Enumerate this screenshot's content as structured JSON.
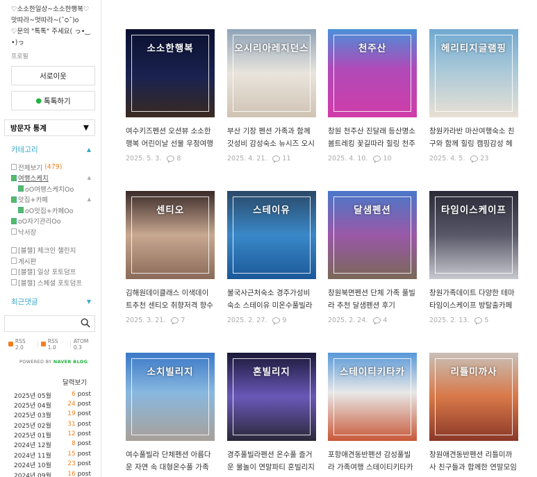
{
  "sidebar": {
    "profile_text": "♡소소한일상~소소한행복♡맛따라~멋따라~(ˆ੦ˆ)о　　　♡문의 \"톡톡\" 주세요( っ•‿•)っ",
    "profile_link": "프로필",
    "neighbor_btn": "서로이웃",
    "talk_btn": "톡톡하기",
    "stats_label": "방문자 통계",
    "stats_arrow": "▼",
    "category_title": "카테고리",
    "categories": [
      {
        "label": "전체보기",
        "count": "(479)",
        "sub": false,
        "icon": false,
        "toggle": ""
      },
      {
        "label": "여행스케치",
        "count": "",
        "sub": false,
        "icon": true,
        "toggle": "▲",
        "active": true
      },
      {
        "label": "oO여행스케치Oo",
        "count": "",
        "sub": true,
        "icon": true,
        "toggle": ""
      },
      {
        "label": "맛집+카페",
        "count": "",
        "sub": false,
        "icon": true,
        "toggle": "▲"
      },
      {
        "label": "oO맛집+카페Oo",
        "count": "",
        "sub": true,
        "icon": true,
        "toggle": ""
      },
      {
        "label": "oO자기관리Oo",
        "count": "",
        "sub": false,
        "icon": true,
        "toggle": ""
      },
      {
        "label": "낙서장",
        "count": "",
        "sub": false,
        "icon": false,
        "toggle": ""
      }
    ],
    "categories2": [
      {
        "label": "[블챌] 체크인 챌린지"
      },
      {
        "label": "게시판"
      },
      {
        "label": "[블챌] 일상 포토덤프"
      },
      {
        "label": "[블챌] 스페셜 포토덤프"
      }
    ],
    "recent_title": "최근댓글",
    "rss": [
      "RSS 2.0",
      "RSS 1.0",
      "ATOM 0.3"
    ],
    "powered": "POWERED BY",
    "powered_brand": "NAVER BLOG",
    "archive_title": "달력보기",
    "archive": [
      {
        "month": "2025년 05월",
        "count": "6",
        "unit": "post"
      },
      {
        "month": "2025년 04월",
        "count": "24",
        "unit": "post"
      },
      {
        "month": "2025년 03월",
        "count": "19",
        "unit": "post"
      },
      {
        "month": "2025년 02월",
        "count": "31",
        "unit": "post"
      },
      {
        "month": "2025년 01월",
        "count": "12",
        "unit": "post"
      },
      {
        "month": "2024년 12월",
        "count": "8",
        "unit": "post"
      },
      {
        "month": "2024년 11월",
        "count": "15",
        "unit": "post"
      },
      {
        "month": "2024년 10월",
        "count": "23",
        "unit": "post"
      },
      {
        "month": "2024년 09월",
        "count": "16",
        "unit": "post"
      }
    ]
  },
  "posts": [
    {
      "thumb_title": "소소한행복",
      "thumb_sub": "",
      "title": "여수키즈펜션 오션뷰 소소한행복 어린이날 선물 우정여행",
      "date": "2025. 5. 3.",
      "comments": "8",
      "bg": "linear-gradient(180deg,#0b1030 0%,#1a2350 55%,#3a2a20 100%)"
    },
    {
      "thumb_title": "오시리아레지던스",
      "thumb_sub": "",
      "title": "부산 기장 펜션 가족과 함께 갓성비 감성숙소 뉴시즈 오시리아 레지던스...",
      "date": "2025. 4. 21.",
      "comments": "11",
      "bg": "linear-gradient(180deg,#8fa3b8 0%,#e9e4dc 50%,#cfc3b3 100%)"
    },
    {
      "thumb_title": "천주산",
      "thumb_sub": "",
      "title": "창원 천주산 진달래 등산명소 봄트레킹 꽃길따라 힐링 천주암도 추천",
      "date": "2025. 4. 10.",
      "comments": "10",
      "bg": "linear-gradient(180deg,#4a8fd8 0%,#b04ab8 45%,#d03ca8 100%)"
    },
    {
      "thumb_title": "헤리티지글램핑",
      "thumb_sub": "",
      "title": "창원카라반 마산여행숙소 친구와 함께 힐링 캠핑감성 헤리티지글램핑",
      "date": "2025. 4. 5.",
      "comments": "23",
      "bg": "linear-gradient(180deg,#6fa8d0 0%,#a8c8d8 45%,#e8e0d4 100%)"
    },
    {
      "thumb_title": "센티오",
      "thumb_sub": "",
      "title": "김해원데이클래스 이색데이트추천 센티오 취향저격 향수만들기",
      "date": "2025. 3. 21.",
      "comments": "7",
      "bg": "linear-gradient(180deg,#3a2a28 0%,#c8a890 50%,#8a6a58 100%)"
    },
    {
      "thumb_title": "스테이유",
      "thumb_sub": "",
      "title": "불국사근처숙소 경주가성비숙소 스테이유 미온수풀빌라펜션 가족여행후기",
      "date": "2025. 2. 27.",
      "comments": "9",
      "bg": "linear-gradient(180deg,#2a4868 0%,#3a88c8 50%,#1a5898 100%)"
    },
    {
      "thumb_title": "달샘펜션",
      "thumb_sub": "",
      "title": "창원북면펜션 단체 가족 풀빌라 추천 달샘펜션 후기",
      "date": "2025. 2. 24.",
      "comments": "4",
      "bg": "linear-gradient(180deg,#4a78c8 0%,#9a58a8 50%,#7a6858 100%)"
    },
    {
      "thumb_title": "타임이스케이프",
      "thumb_sub": "",
      "title": "창원가족데이트 다양한 테마 타임이스케이프 방탈출카페 즐겨봐",
      "date": "2025. 2. 13.",
      "comments": "5",
      "bg": "linear-gradient(180deg,#2a2a38 0%,#585868 50%,#c8c8d0 100%)"
    },
    {
      "thumb_title": "소치빌리지",
      "thumb_sub": "",
      "title": "여수풀빌라 단체펜션 아름다운 자연 속 대형온수풀 가족모임 단체모임 힐...",
      "date": "",
      "comments": "",
      "bg": "linear-gradient(180deg,#3a78c8 0%,#88b8e0 45%,#a8a098 100%)"
    },
    {
      "thumb_title": "혼빌리지",
      "thumb_sub": "",
      "title": "경주풀빌라펜션 온수풀 즐거운 물놀이 연말파티 혼빌리지 A101호 칠...",
      "date": "",
      "comments": "",
      "bg": "linear-gradient(180deg,#1a1838 0%,#6a58b8 50%,#2a2838 100%)"
    },
    {
      "thumb_title": "스테이티키타카",
      "thumb_sub": "",
      "title": "포항애견동반펜션 감성풀빌라 가족여행 스테이티키타카 프라이빗A4호 숙소...",
      "date": "",
      "comments": "",
      "bg": "linear-gradient(180deg,#5898d8 0%,#e8e8e8 45%,#c85838 100%)"
    },
    {
      "thumb_title": "리틀미까사",
      "thumb_sub": "",
      "title": "창원애견동반펜션 리틀미까사 친구들과 함께한 연말모임 우정여행",
      "date": "",
      "comments": "",
      "bg": "linear-gradient(180deg,#c8c0b8 0%,#d87848 50%,#8a3828 100%)"
    }
  ]
}
